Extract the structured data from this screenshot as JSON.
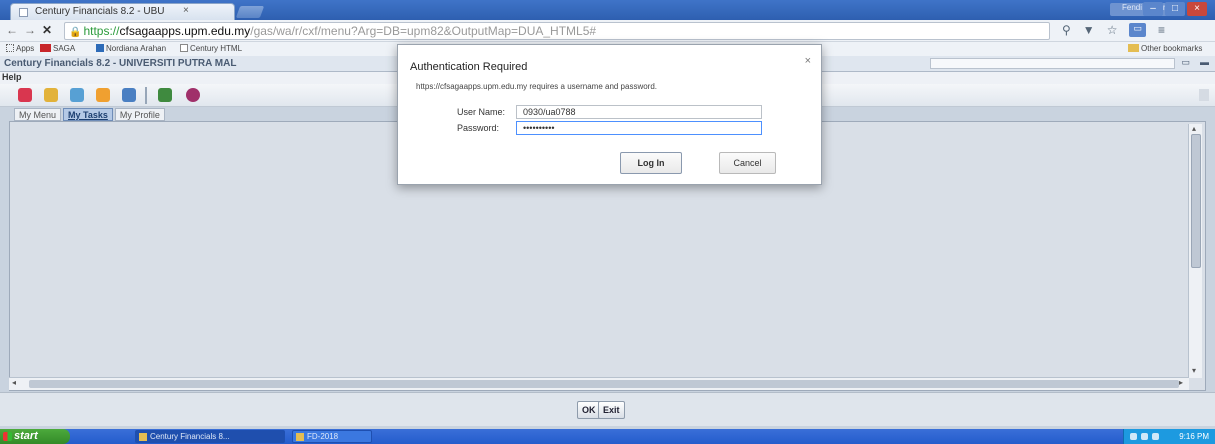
{
  "browser": {
    "tab_title": "Century Financials 8.2 - UBU",
    "tab_close": "×",
    "user_chip": "Fendi Sudarto",
    "window_controls": [
      "–",
      "□",
      "×"
    ],
    "url": {
      "scheme": "https://",
      "host": "cfsagaapps.upm.edu.my",
      "path": "/gas/wa/r/cxf/menu?Arg=DB=upm82&OutputMap=DUA_HTML5#"
    },
    "bookmarks": [
      "Apps",
      "SAGA",
      "Nordiana Arahan",
      "Century HTML",
      "Other bookmarks"
    ]
  },
  "app": {
    "title": "Century Financials 8.2 - UNIVERSITI PUTRA MAL",
    "menu_help": "Help",
    "tabs": [
      {
        "label": "My Menu",
        "active": false
      },
      {
        "label": "My Tasks",
        "active": true
      },
      {
        "label": "My Profile",
        "active": false
      }
    ],
    "toolbar_icons": [
      {
        "name": "bell-icon",
        "color": "#d9364f"
      },
      {
        "name": "folder-icon",
        "color": "#e2b23a"
      },
      {
        "name": "tools-icon",
        "color": "#57a0d4"
      },
      {
        "name": "star-icon",
        "color": "#f0a030"
      },
      {
        "name": "chart-icon",
        "color": "#4a7fc2"
      },
      {
        "name": "arrow-icon",
        "color": "#3f8a3f"
      },
      {
        "name": "help-icon",
        "color": "#a0306a"
      }
    ],
    "footer_buttons": {
      "ok": "OK",
      "exit": "Exit"
    }
  },
  "dialog": {
    "title": "Authentication Required",
    "close": "×",
    "message": "https://cfsagaapps.upm.edu.my requires a username and password.",
    "username_label": "User Name:",
    "username_value": "0930/ua0788",
    "password_label": "Password:",
    "password_value": "••••••••••",
    "login_button": "Log In",
    "cancel_button": "Cancel"
  },
  "taskbar": {
    "start": "start",
    "tasks": [
      "Century Financials 8...",
      "FD-2018"
    ],
    "clock": "9:16 PM"
  }
}
